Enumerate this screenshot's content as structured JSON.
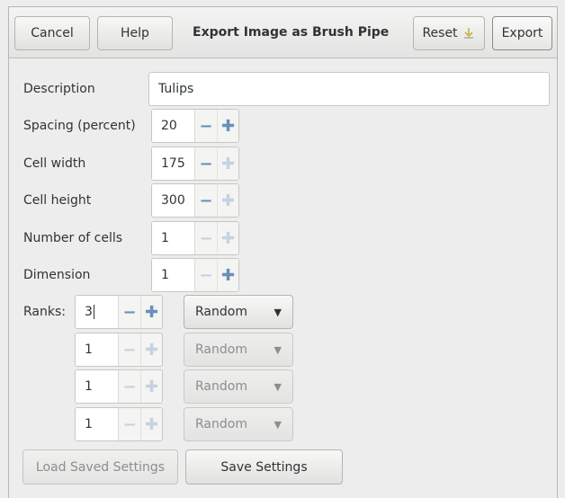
{
  "header": {
    "cancel_label": "Cancel",
    "help_label": "Help",
    "title": "Export Image as Brush Pipe",
    "reset_label": "Reset",
    "reset_icon": "reset-icon",
    "export_label": "Export"
  },
  "form": {
    "description_label": "Description",
    "description_value": "Tulips",
    "spacing_label": "Spacing (percent)",
    "spacing_value": "20",
    "cell_width_label": "Cell width",
    "cell_width_value": "175",
    "cell_height_label": "Cell height",
    "cell_height_value": "300",
    "num_cells_label": "Number of cells",
    "num_cells_value": "1",
    "dimension_label": "Dimension",
    "dimension_value": "1",
    "ranks_label": "Ranks:",
    "ranks": [
      {
        "value": "3",
        "selection": "Random"
      },
      {
        "value": "1",
        "selection": "Random"
      },
      {
        "value": "1",
        "selection": "Random"
      },
      {
        "value": "1",
        "selection": "Random"
      }
    ]
  },
  "footer": {
    "load_label": "Load Saved Settings",
    "save_label": "Save Settings"
  },
  "symbols": {
    "minus": "−",
    "plus": "✚",
    "caret": "▼"
  },
  "colors": {
    "spin_accent": "#6b8fb8",
    "disabled_text": "#8b8e8f"
  }
}
